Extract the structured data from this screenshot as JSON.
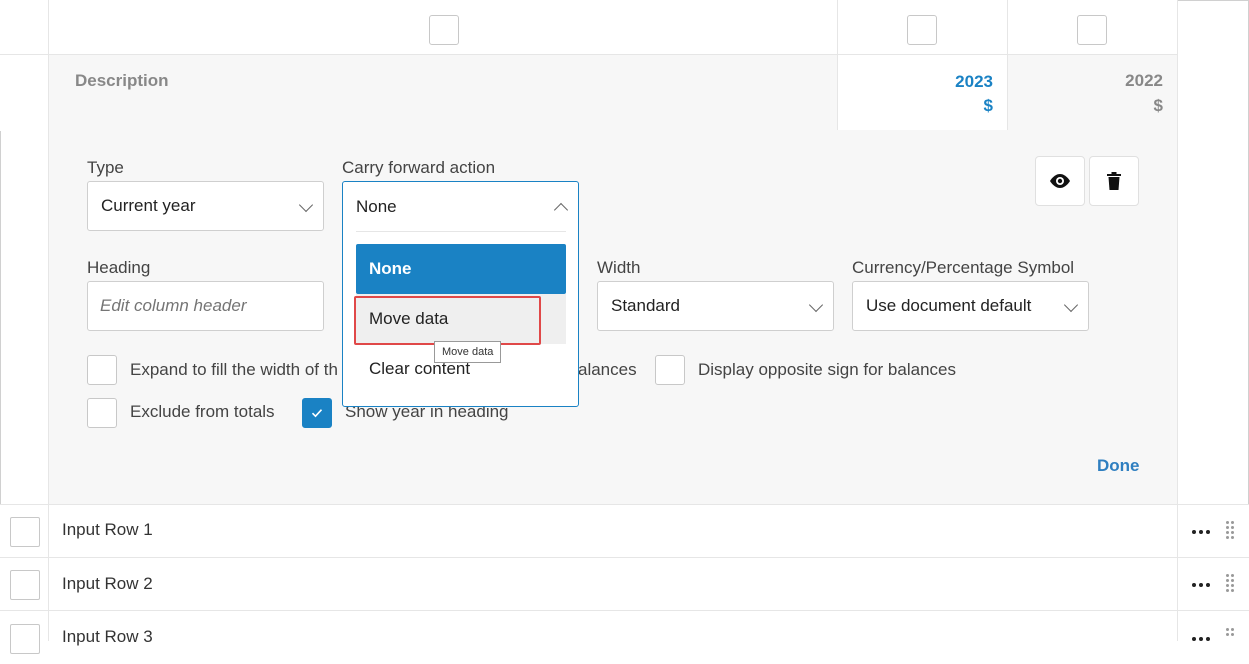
{
  "header": {
    "description_label": "Description",
    "col_2023": {
      "year": "2023",
      "symbol": "$"
    },
    "col_2022": {
      "year": "2022",
      "symbol": "$"
    }
  },
  "panel": {
    "type": {
      "label": "Type",
      "value": "Current year"
    },
    "carry_forward": {
      "label": "Carry forward action",
      "value": "None",
      "options": [
        "None",
        "Move data",
        "Clear content"
      ],
      "selected_index": 0,
      "hovered_index": 1,
      "tooltip": "Move data"
    },
    "heading": {
      "label": "Heading",
      "placeholder": "Edit column header"
    },
    "width": {
      "label": "Width",
      "value": "Standard"
    },
    "currency": {
      "label": "Currency/Percentage Symbol",
      "value": "Use document default"
    },
    "checkboxes": {
      "expand": {
        "label": "Expand to fill the width of th",
        "checked": false
      },
      "balances_suffix": "alances",
      "opposite_sign": {
        "label": "Display opposite sign for balances",
        "checked": false
      },
      "exclude_totals": {
        "label": "Exclude from totals",
        "checked": false
      },
      "show_year": {
        "label": "Show year in heading",
        "checked": true
      }
    },
    "done_label": "Done"
  },
  "rows": [
    {
      "label": "Input Row 1"
    },
    {
      "label": "Input Row 2"
    },
    {
      "label": "Input Row 3"
    }
  ],
  "colors": {
    "accent": "#1a82c4",
    "highlight_border": "#e04848"
  },
  "icons": {
    "view": "eye-icon",
    "delete": "trash-icon",
    "check": "checkmark-icon"
  }
}
